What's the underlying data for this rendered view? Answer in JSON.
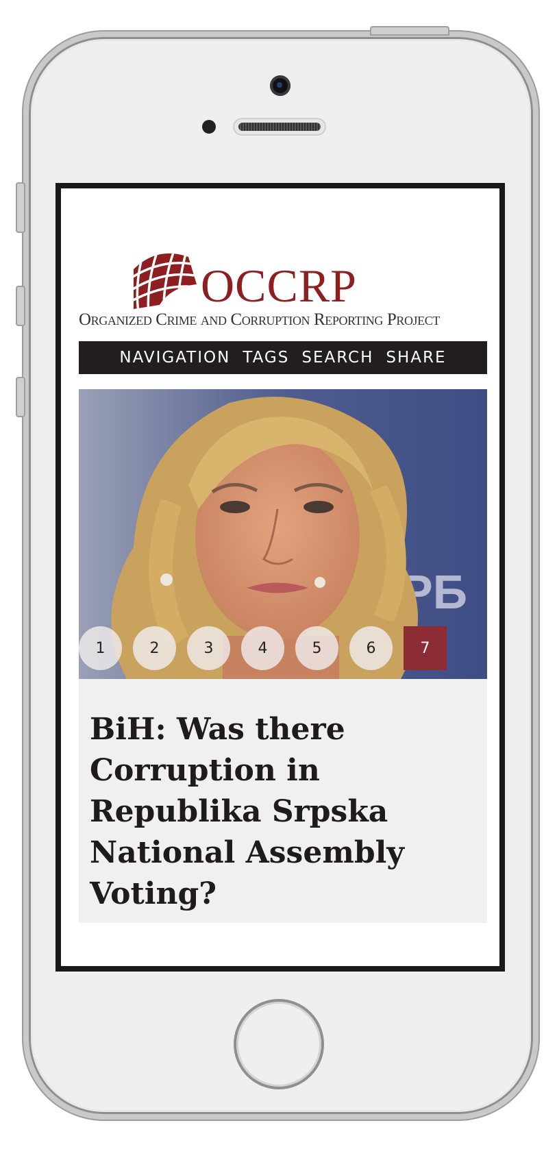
{
  "logo": {
    "name": "OCCRP",
    "tagline": "Organized Crime and Corruption Reporting Project"
  },
  "nav": [
    "NAVIGATION",
    "TAGS",
    "SEARCH",
    "SHARE"
  ],
  "slider": {
    "pages": [
      "1",
      "2",
      "3",
      "4",
      "5",
      "6",
      "7"
    ],
    "active": "7"
  },
  "article": {
    "headline": "BiH: Was there Corruption in Republika Srpska National Assembly Voting?"
  },
  "colors": {
    "brand": "#8e1f21",
    "navbar": "#221e20",
    "active_page": "#8c2d35"
  },
  "icons": [
    "camera-icon",
    "speaker-icon",
    "home-button-icon"
  ]
}
